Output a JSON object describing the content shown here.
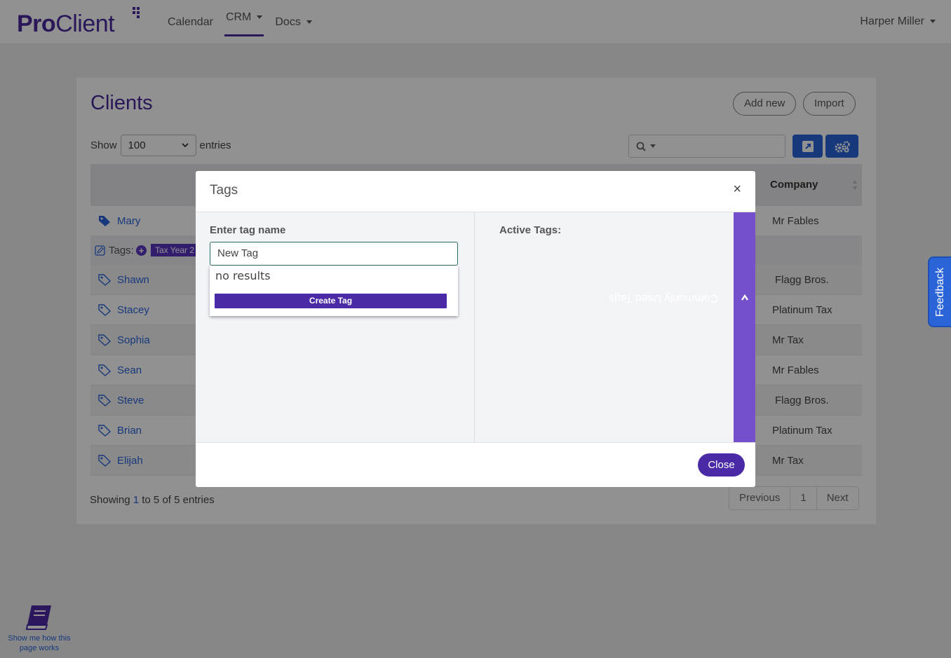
{
  "app": {
    "logo_pro": "Pro",
    "logo_client": "Client"
  },
  "nav": {
    "items": [
      {
        "label": "Calendar"
      },
      {
        "label": "CRM"
      },
      {
        "label": "Docs"
      }
    ],
    "user": "Harper Miller"
  },
  "page": {
    "title": "Clients",
    "add_new": "Add new",
    "import": "Import",
    "show_label": "Show",
    "entries_label": "entries",
    "page_size": "100",
    "column_company": "Company",
    "tags_label": "Tags:",
    "tag_chip": "Tax Year 2",
    "rows": [
      {
        "name": "Mary",
        "company": "Mr Fables"
      },
      {
        "name": "Shawn",
        "company": "Flagg Bros."
      },
      {
        "name": "Stacey",
        "company": "Platinum Tax"
      },
      {
        "name": "Sophia",
        "company": "Mr Tax"
      },
      {
        "name": "Sean",
        "company": "Mr Fables"
      },
      {
        "name": "Steve",
        "company": "Flagg Bros."
      },
      {
        "name": "Brian",
        "company": "Platinum Tax"
      },
      {
        "name": "Elijah",
        "company": "Mr Tax"
      }
    ],
    "showing_prefix": "Showing",
    "showing_from": "1",
    "showing_to_word": "to",
    "showing_to": "5",
    "showing_of_word": "of",
    "showing_total": "5",
    "showing_suffix": "entries",
    "pager": {
      "previous": "Previous",
      "current": "1",
      "next": "Next"
    }
  },
  "modal": {
    "title": "Tags",
    "close_x": "×",
    "enter_label": "Enter tag name",
    "input_value": "New Tag",
    "no_results": "no results",
    "create_tag": "Create Tag",
    "active_tags": "Active Tags:",
    "side_tab": "Commonly Used Tags",
    "close_button": "Close"
  },
  "feedback": "Feedback",
  "help": "Show me how this page works",
  "colors": {
    "brand": "#4a2a9e",
    "link": "#2a64d8",
    "tag_purple": "#7550cc"
  }
}
